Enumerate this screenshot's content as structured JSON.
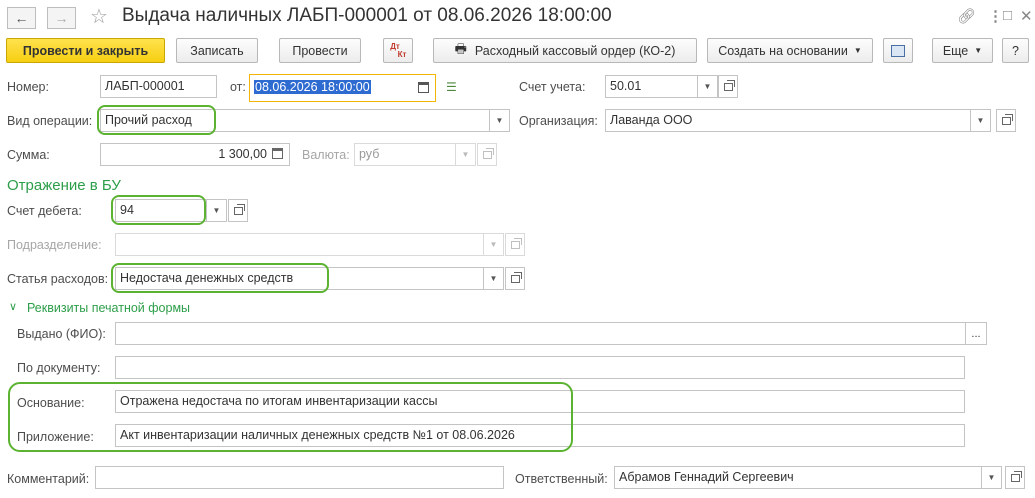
{
  "window": {
    "title": "Выдача наличных ЛАБП-000001 от 08.06.2026 18:00:00",
    "back_icon": "arrow-left-icon",
    "forward_icon": "arrow-right-icon",
    "favorite_icon": "star-icon",
    "link_icon": "link-icon",
    "menu_icon": "more-vertical-icon",
    "maximize_icon": "maximize-icon",
    "close_icon": "close-icon"
  },
  "toolbar": {
    "post_close_label": "Провести и закрыть",
    "save_label": "Записать",
    "post_label": "Провести",
    "dtkt_top": "Дт",
    "dtkt_bottom": "Кт",
    "print_label": "Расходный кассовый ордер (КО-2)",
    "create_based_label": "Создать на основании",
    "more_label": "Еще",
    "help_label": "?"
  },
  "form": {
    "number_label": "Номер:",
    "number_value": "ЛАБП-000001",
    "date_label": "от:",
    "date_value": "08.06.2026 18:00:00",
    "account_label": "Счет учета:",
    "account_value": "50.01",
    "operation_label": "Вид операции:",
    "operation_value": "Прочий расход",
    "org_label": "Организация:",
    "org_value": "Лаванда ООО",
    "sum_label": "Сумма:",
    "sum_value": "1 300,00",
    "currency_label": "Валюта:",
    "currency_value": "руб"
  },
  "accounting": {
    "section_title": "Отражение в БУ",
    "debit_label": "Счет дебета:",
    "debit_value": "94",
    "division_label": "Подразделение:",
    "division_value": "",
    "expense_label": "Статья расходов:",
    "expense_value": "Недостача денежных средств"
  },
  "print_details": {
    "toggle_label": "Реквизиты печатной формы",
    "issued_label": "Выдано (ФИО):",
    "issued_value": "",
    "issued_button": "...",
    "document_label": "По документу:",
    "document_value": "",
    "basis_label": "Основание:",
    "basis_value": "Отражена недостача по итогам инвентаризации кассы",
    "attachment_label": "Приложение:",
    "attachment_value": "Акт инвентаризации наличных денежных средств №1 от 08.06.2026"
  },
  "footer": {
    "comment_label": "Комментарий:",
    "comment_value": "",
    "responsible_label": "Ответственный:",
    "responsible_value": "Абрамов Геннадий Сергеевич"
  },
  "colors": {
    "accent_green": "#2d9e4a",
    "highlight_oval": "#5cb231",
    "primary_button": "#f6cf12",
    "date_border": "#f2b705",
    "selection": "#2d6bd1"
  }
}
